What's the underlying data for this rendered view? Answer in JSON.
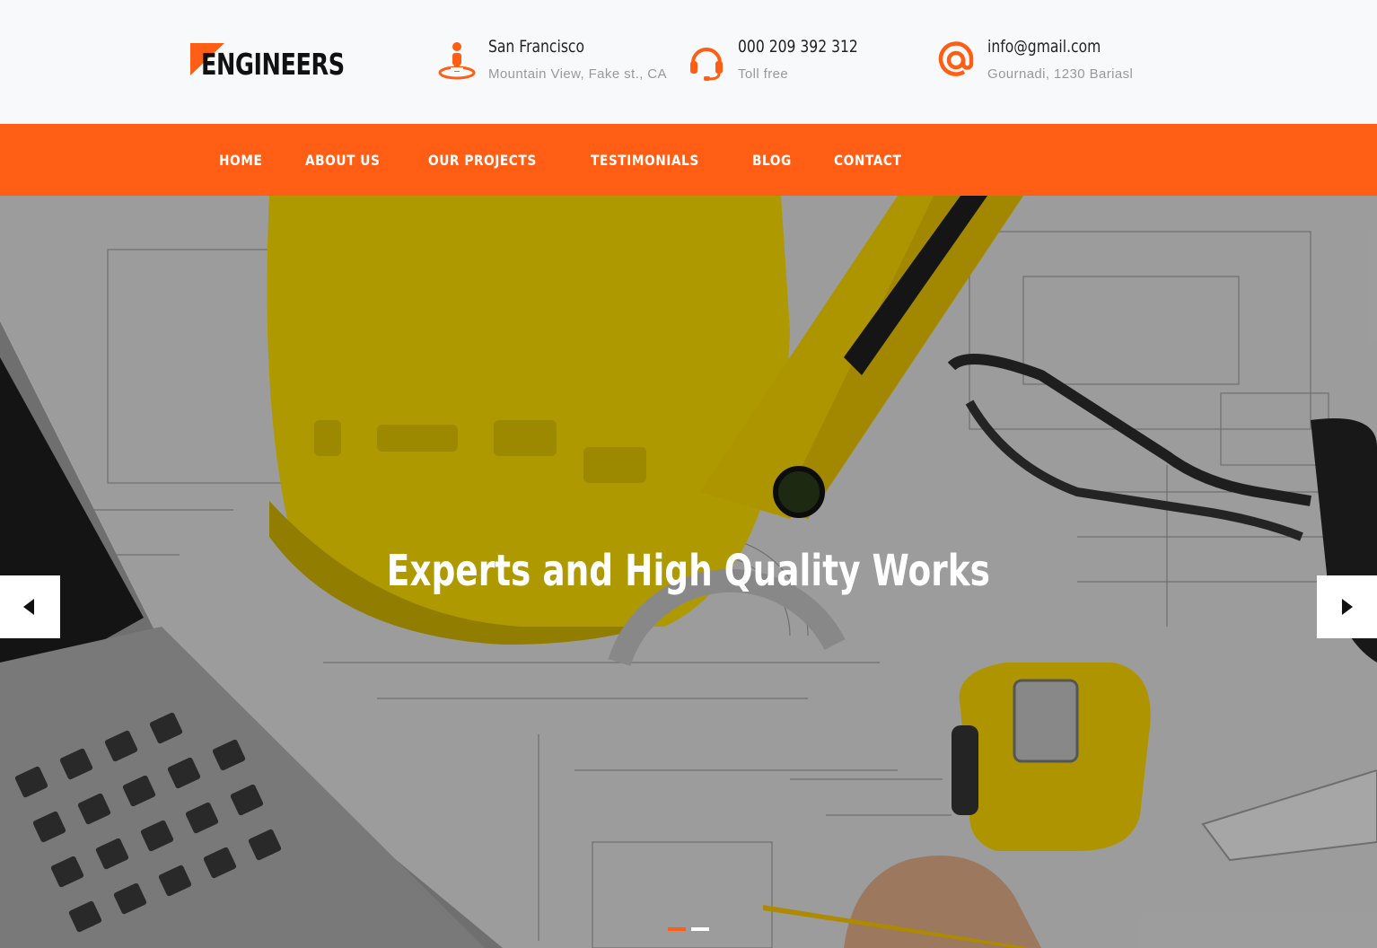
{
  "brand": {
    "name": "ENGINEERS",
    "accent": "#ff5e14"
  },
  "contacts": [
    {
      "icon": "location-person-icon",
      "title": "San Francisco",
      "sub": "Mountain View, Fake st., CA"
    },
    {
      "icon": "headset-icon",
      "title": "000 209 392 312",
      "sub": "Toll free"
    },
    {
      "icon": "at-sign-icon",
      "title": "info@gmail.com",
      "sub": "Gournadi, 1230 Bariasl"
    }
  ],
  "nav": {
    "items": [
      "HOME",
      "ABOUT US",
      "OUR PROJECTS",
      "TESTIMONIALS",
      "BLOG",
      "CONTACT"
    ]
  },
  "hero": {
    "title": "Experts and High Quality Works",
    "prev_icon": "caret-left-icon",
    "next_icon": "caret-right-icon",
    "slides_count": 2,
    "active_slide": 1
  }
}
